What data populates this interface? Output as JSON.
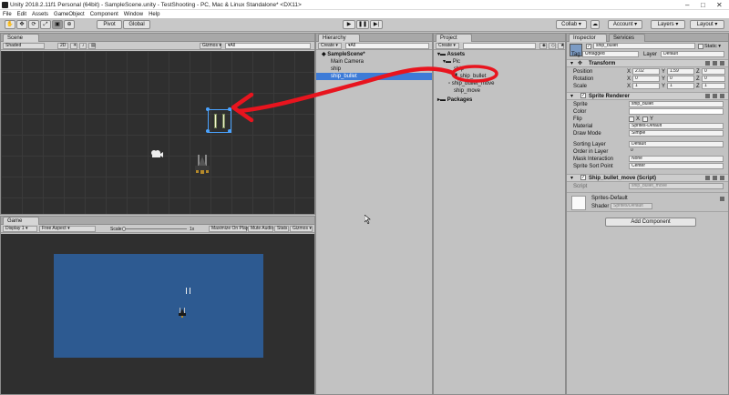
{
  "window": {
    "title": "Unity 2018.2.11f1 Personal (64bit) - SampleScene.unity - TestShooting - PC, Mac & Linux Standalone* <DX11>"
  },
  "menu": [
    "File",
    "Edit",
    "Assets",
    "GameObject",
    "Component",
    "Window",
    "Help"
  ],
  "toolbar": {
    "pivot": "Pivot",
    "global": "Global",
    "collab": "Collab ▾",
    "account": "Account ▾",
    "layers": "Layers ▾",
    "layout": "Layout ▾",
    "play": "▶",
    "pause": "❚❚",
    "step": "▶|"
  },
  "scene": {
    "tab": "Scene",
    "shading": "Shaded",
    "mode2d": "2D",
    "gizmos": "Gizmos ▾",
    "search": "▾All"
  },
  "game": {
    "tab": "Game",
    "display": "Display 1 ▾",
    "aspect": "Free Aspect ▾",
    "scale_label": "Scale",
    "scale_value": "1x",
    "buttons": [
      "Maximize On Play",
      "Mute Audio",
      "Stats",
      "Gizmos ▾"
    ]
  },
  "hierarchy": {
    "tab": "Hierarchy",
    "create": "Create ▾",
    "search": "▾All",
    "scene": "SampleScene*",
    "items": [
      "Main Camera",
      "ship",
      "ship_bullet"
    ]
  },
  "project": {
    "tab": "Project",
    "create": "Create ▾",
    "assets": "Assets",
    "pic": "Pic",
    "items": [
      "ship",
      "ship_bullet",
      "ship_bullet_move",
      "ship_move"
    ],
    "packages": "Packages"
  },
  "inspector": {
    "tabs": [
      "Inspector",
      "Services"
    ],
    "name": "ship_bullet",
    "static": "Static ▾",
    "tag_label": "Tag",
    "tag": "Untagged",
    "layer_label": "Layer",
    "layer": "Default",
    "transform": {
      "title": "Transform",
      "position": {
        "label": "Position",
        "x": "2.02",
        "y": "1.59",
        "z": "0"
      },
      "rotation": {
        "label": "Rotation",
        "x": "0",
        "y": "0",
        "z": "0"
      },
      "scale": {
        "label": "Scale",
        "x": "1",
        "y": "1",
        "z": "1"
      }
    },
    "sprite_renderer": {
      "title": "Sprite Renderer",
      "sprite_label": "Sprite",
      "sprite": "ship_bullet",
      "color_label": "Color",
      "flip_label": "Flip",
      "flip_x": "X",
      "flip_y": "Y",
      "material_label": "Material",
      "material": "Sprites-Default",
      "draw_mode_label": "Draw Mode",
      "draw_mode": "Simple",
      "sorting_layer_label": "Sorting Layer",
      "sorting_layer": "Default",
      "order_label": "Order in Layer",
      "order": "0",
      "mask_label": "Mask Interaction",
      "mask": "None",
      "sort_point_label": "Sprite Sort Point",
      "sort_point": "Center"
    },
    "script": {
      "title": "Ship_bullet_move (Script)",
      "label": "Script",
      "value": "ship_bullet_move"
    },
    "material": {
      "name": "Sprites-Default",
      "shader_label": "Shader",
      "shader": "Sprites/Default"
    },
    "add_component": "Add Component"
  },
  "colors": {
    "annotation_red": "#e8141e",
    "selection_blue": "#3d7bd7",
    "game_blue": "#2d5a91",
    "viewport_dark": "#2f2f2f"
  }
}
